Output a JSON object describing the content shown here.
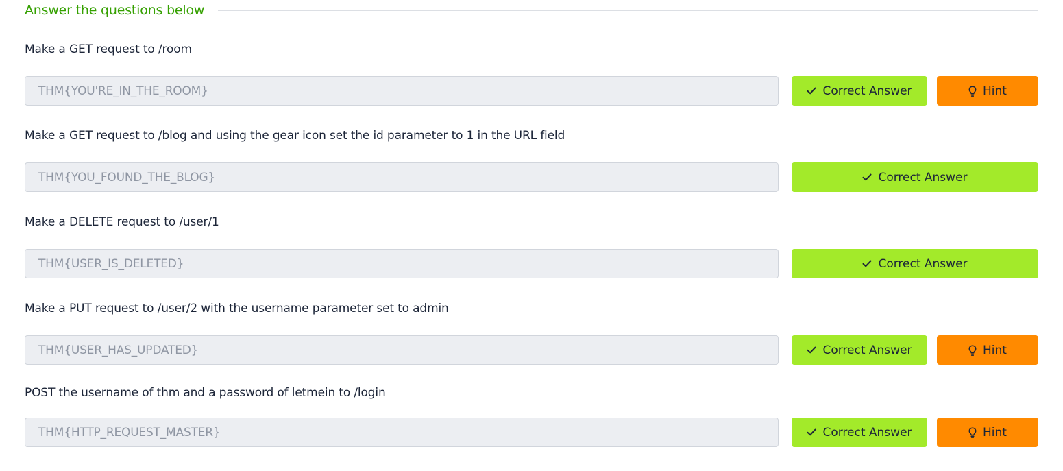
{
  "section": {
    "title": "Answer the questions below"
  },
  "questions": [
    {
      "text": "Make a GET request to /room",
      "answer": "THM{YOU'RE_IN_THE_ROOM}",
      "correct_label": "Correct Answer",
      "hint_label": "Hint"
    },
    {
      "text": "Make a GET request to /blog and using the gear icon set the id parameter to 1 in the URL field",
      "answer": "THM{YOU_FOUND_THE_BLOG}",
      "correct_label": "Correct Answer"
    },
    {
      "text": "Make a DELETE request to /user/1",
      "answer": "THM{USER_IS_DELETED}",
      "correct_label": "Correct Answer"
    },
    {
      "text": "Make a PUT request to /user/2 with the username parameter set to admin",
      "answer": "THM{USER_HAS_UPDATED}",
      "correct_label": "Correct Answer",
      "hint_label": "Hint"
    },
    {
      "text": "POST the username of thm and a password of letmein to /login",
      "answer": "THM{HTTP_REQUEST_MASTER}",
      "correct_label": "Correct Answer",
      "hint_label": "Hint"
    }
  ],
  "icons": {
    "correct": "check-icon",
    "hint": "lightbulb-icon"
  },
  "colors": {
    "section_title": "#35a000",
    "correct_button": "#a3ea2a",
    "hint_button": "#ff8a00",
    "input_background": "#eceef2"
  }
}
